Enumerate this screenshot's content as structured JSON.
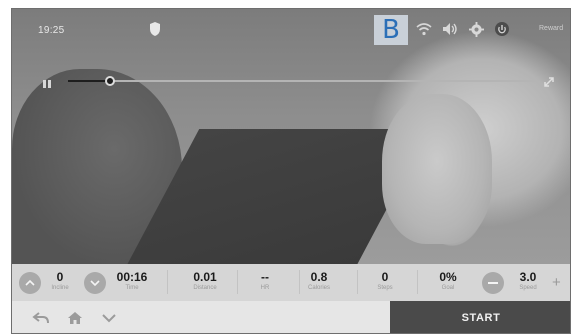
{
  "status_bar": {
    "time": "19:25",
    "brand_mark": "B",
    "icons": [
      "wifi-icon",
      "volume-icon",
      "settings-icon",
      "power-icon"
    ],
    "right_text": "Reward"
  },
  "playback": {
    "progress": 0.09
  },
  "stats": [
    {
      "value": "0",
      "label": "Incline"
    },
    {
      "value": "00:16",
      "label": "Time"
    },
    {
      "value": "0.01",
      "label": "Distance"
    },
    {
      "value": "--",
      "label": "HR"
    },
    {
      "value": "0.8",
      "label": "Calories"
    },
    {
      "value": "0",
      "label": "Steps"
    },
    {
      "value": "0%",
      "label": "Goal"
    },
    {
      "value": "3.0",
      "label": "Speed"
    }
  ],
  "controls": {
    "incline_up": "^",
    "incline_down": "v",
    "speed_down": "−",
    "speed_up": "+"
  },
  "footer": {
    "start_label": "START",
    "nav_icons": [
      "back-icon",
      "home-icon",
      "chevron-down-icon"
    ]
  },
  "colors": {
    "start_bg": "#4a4a4a",
    "stats_bg": "#d6d6d6",
    "brand_blue": "#2b6fb7"
  }
}
